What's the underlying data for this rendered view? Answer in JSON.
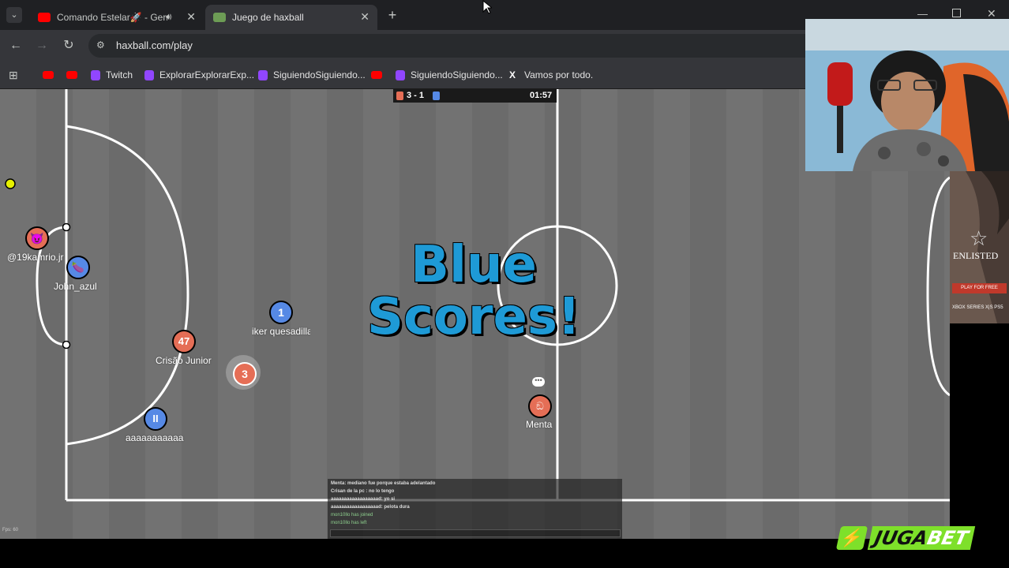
{
  "browser": {
    "tabs": [
      {
        "title": "Comando Estelar🚀 - Germ",
        "active": false,
        "audio": true
      },
      {
        "title": "Juego de haxball",
        "active": true,
        "audio": false
      }
    ],
    "url": "haxball.com/play",
    "bookmarks": [
      {
        "label": "",
        "icon": "youtube-icon"
      },
      {
        "label": "",
        "icon": "youtube-icon"
      },
      {
        "label": "Twitch",
        "icon": "twitch-icon"
      },
      {
        "label": "ExplorarExplorarExp...",
        "icon": "twitch-icon"
      },
      {
        "label": "SiguiendoSiguiendo...",
        "icon": "twitch-icon"
      },
      {
        "label": "",
        "icon": "youtube-icon"
      },
      {
        "label": "SiguiendoSiguiendo...",
        "icon": "twitch-icon"
      },
      {
        "label": "Vamos por todo.",
        "icon": "x-icon"
      }
    ]
  },
  "game": {
    "score": "3 - 1",
    "time": "01:57",
    "banner_line1": "Blue",
    "banner_line2": "Scores!",
    "fps": "Fps: 60",
    "players": [
      {
        "name": "@19kamrio.jr",
        "team": "red",
        "avatar": "😈"
      },
      {
        "name": "John_azul",
        "team": "blue",
        "avatar": "🍆"
      },
      {
        "name": "iker quesadilla",
        "team": "blue",
        "avatar": "1"
      },
      {
        "name": "Crisão Junior",
        "team": "red",
        "avatar": "47"
      },
      {
        "name": "",
        "team": "red",
        "avatar": "3"
      },
      {
        "name": "aaaaaaaaaaa",
        "team": "blue",
        "avatar": "II"
      },
      {
        "name": "Menta",
        "team": "red",
        "avatar": "ඞ"
      }
    ],
    "chat": [
      "Menta: mediano fue porque estaba adelantado",
      "Crisan de la pc : no lo tengo",
      "aaaaaaaaaaaaaaaaaad: yo si",
      "aaaaaaaaaaaaaaaaaad: pelota dura",
      "mon10llo has joined",
      "mon10llo has left"
    ]
  },
  "overlay": {
    "ad_title": "ENLISTED",
    "ad_button": "PLAY FOR FREE",
    "ad_platforms": "XBOX SERIES X|S  PS5",
    "sponsor": "JUGABET",
    "sponsor_part1": "JUGA",
    "sponsor_part2": "BET"
  },
  "colors": {
    "red_team": "#e56e56",
    "blue_team": "#5689e5",
    "pitch": "#6e6e6e",
    "banner": "#1e9ad6"
  }
}
